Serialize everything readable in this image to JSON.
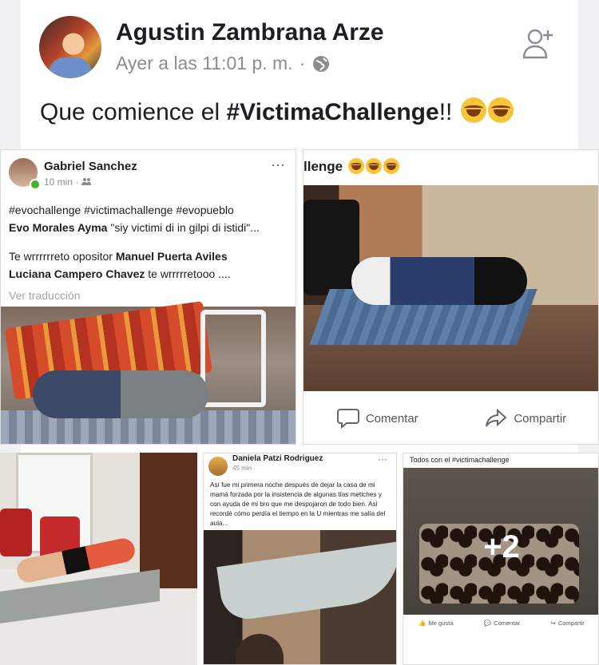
{
  "header": {
    "name": "Agustin Zambrana Arze",
    "time": "Ayer a las 11:01 p. m.",
    "separator": "·"
  },
  "post": {
    "text_prefix": "Que comience el ",
    "hashtag": "#VictimaChallenge",
    "text_suffix": "!! "
  },
  "panel1": {
    "name": "Gabriel Sanchez",
    "time": "10 min ·",
    "more": "···",
    "line1": "#evochallenge #victimachallenge #evopueblo",
    "line2_bold": "Evo Morales Ayma",
    "line2_rest": " \"siy victimi di in gilpi di istidi\"...",
    "line3_prefix": "Te wrrrrrreto opositor ",
    "line3_bold": "Manuel Puerta Aviles",
    "line4_bold": "Luciana Campero Chavez",
    "line4_rest": " te wrrrrretooo ....",
    "translate": "Ver traducción"
  },
  "panel2": {
    "title": "llenge",
    "comment": "Comentar",
    "share": "Compartir"
  },
  "panel4": {
    "name": "Daniela Patzi Rodriguez",
    "time": "45 min ·",
    "more": "···",
    "text": "Así fue mi primera noche después de dejar la casa de mi mamá forzada por la insistencia de algunas tías metiches y con ayuda de mi bro que me despojaron de todo bien. Así recordé cómo perdía el tiempo en la U mientras me salía del aula..."
  },
  "panel5": {
    "title": "Todos con el #victimachallenge",
    "more_count": "+2",
    "like": "Me gusta",
    "comment": "Comentar",
    "share": "Compartir"
  }
}
